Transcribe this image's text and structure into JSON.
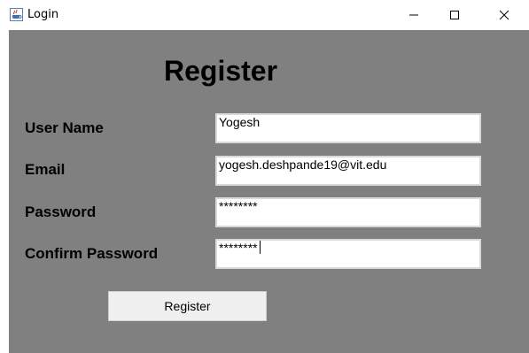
{
  "window": {
    "title": "Login",
    "app_icon": "java-cup-icon",
    "controls": {
      "minimize_icon": "minimize-icon",
      "maximize_icon": "maximize-icon",
      "close_icon": "close-icon"
    }
  },
  "form": {
    "heading": "Register",
    "fields": [
      {
        "label": "User Name",
        "value": "Yogesh",
        "type": "text"
      },
      {
        "label": "Email",
        "value": "yogesh.deshpande19@vit.edu",
        "type": "text"
      },
      {
        "label": "Password",
        "value": "********",
        "type": "password"
      },
      {
        "label": "Confirm Password",
        "value": "********",
        "type": "password",
        "focused": true
      }
    ],
    "submit_label": "Register"
  },
  "colors": {
    "panel_background": "#808080",
    "titlebar_background": "#ffffff",
    "button_background": "#f0f0f0"
  }
}
